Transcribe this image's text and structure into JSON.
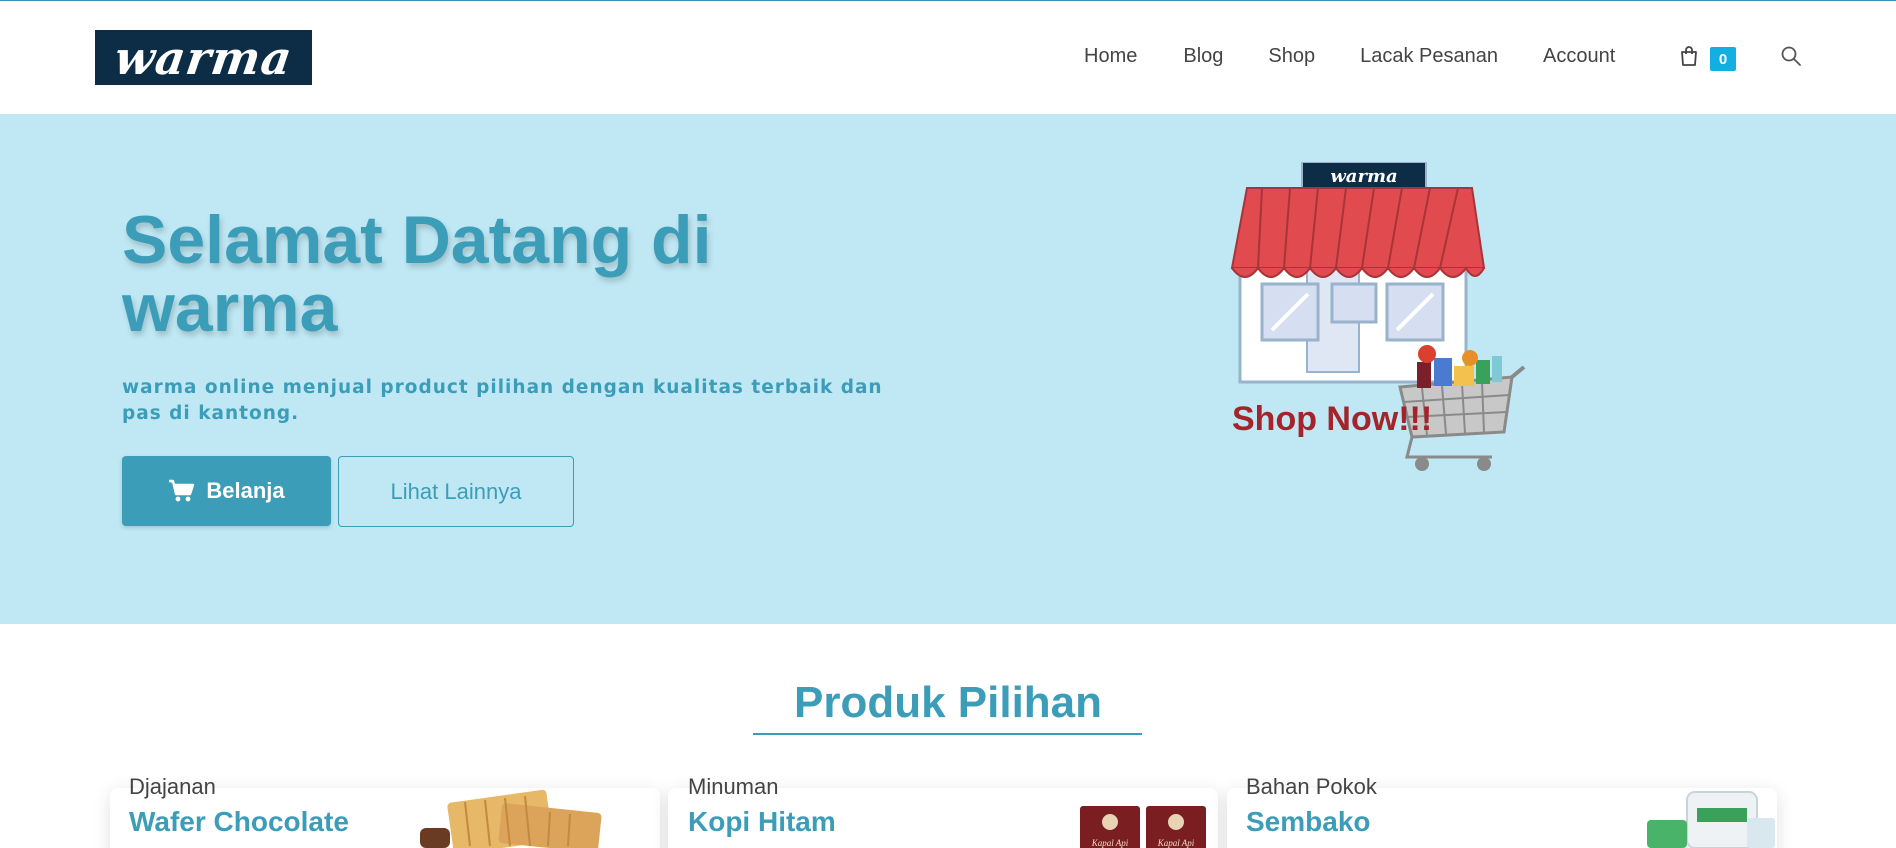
{
  "brand": {
    "logo_text": "warma",
    "logo_bg": "#0d2d47"
  },
  "nav": {
    "items": [
      {
        "label": "Home"
      },
      {
        "label": "Blog"
      },
      {
        "label": "Shop"
      },
      {
        "label": "Lacak Pesanan"
      },
      {
        "label": "Account"
      }
    ],
    "cart_icon": "shopping-bag-icon",
    "cart_count": "0",
    "search_icon": "search-icon"
  },
  "hero": {
    "title": "Selamat Datang di warma",
    "subtitle": "warma online menjual product pilihan dengan kualitas terbaik dan pas di kantong.",
    "primary_button": "Belanja",
    "secondary_button": "Lihat Lainnya",
    "image": {
      "sign_text": "warma",
      "cta_text": "Shop Now!!!"
    },
    "bg_color": "#bfe8f4",
    "accent_color": "#3c9db9"
  },
  "products": {
    "section_title": "Produk Pilihan",
    "cards": [
      {
        "category": "Djajanan",
        "name": "Wafer Chocolate"
      },
      {
        "category": "Minuman",
        "name": "Kopi Hitam",
        "image_text": "Kapal Api"
      },
      {
        "category": "Bahan Pokok",
        "name": "Sembako"
      }
    ]
  }
}
